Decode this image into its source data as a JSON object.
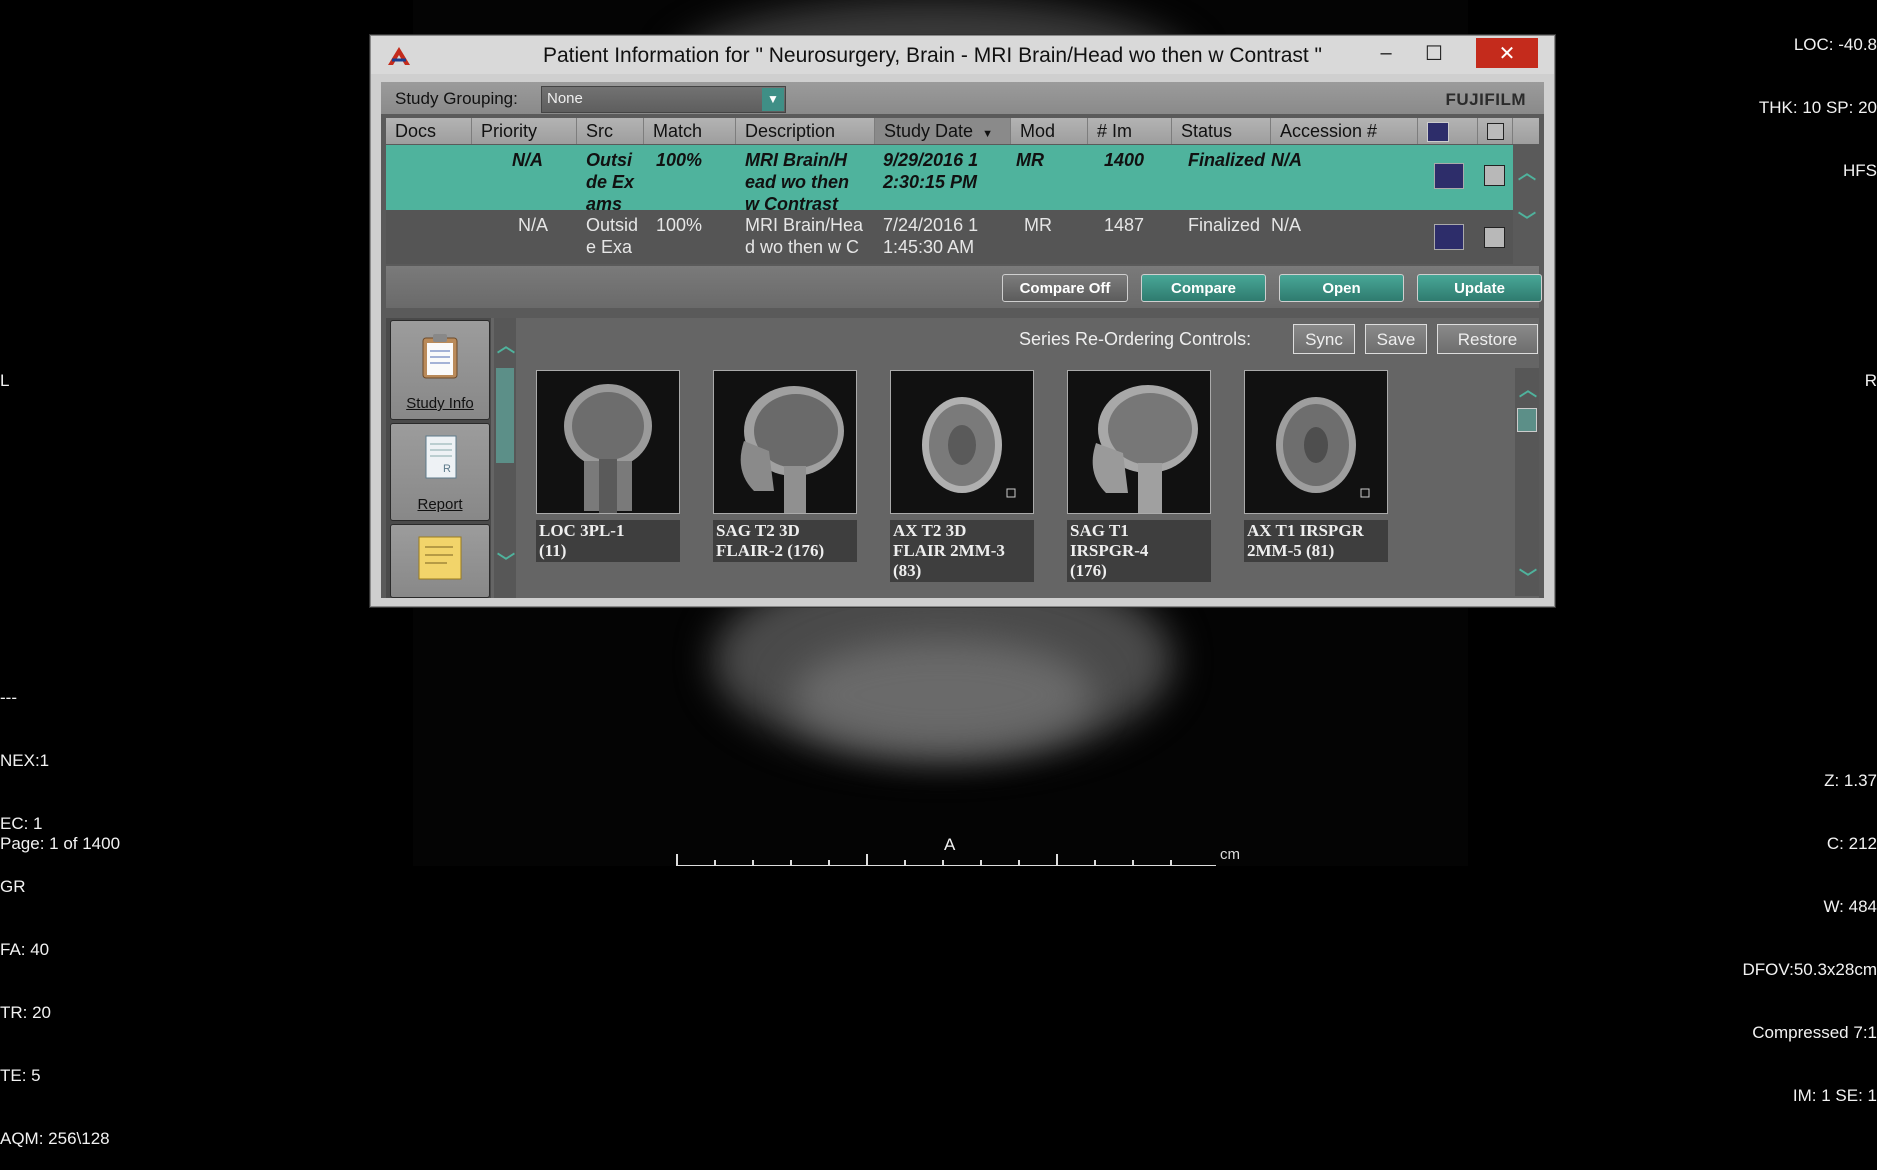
{
  "overlay": {
    "top_right": [
      "LOC: -40.8",
      "THK: 10 SP: 20",
      "HFS"
    ],
    "left_mid": "L",
    "right_mid": "R",
    "bottom_left": [
      "---",
      "NEX:1",
      "EC: 1",
      "GR",
      "FA: 40",
      "TR: 20",
      "TE: 5",
      "AQM: 256\\128"
    ],
    "page": "Page: 1 of 1400",
    "bottom_right": [
      "Z: 1.37",
      "C: 212",
      "W: 484",
      "DFOV:50.3x28cm",
      "Compressed 7:1",
      "IM: 1 SE: 1"
    ],
    "bottom_center": "A",
    "ruler_unit": "cm"
  },
  "window": {
    "title": "Patient Information for \" Neurosurgery, Brain  - MRI Brain/Head wo then w Contrast \"",
    "min_glyph": "–",
    "max_glyph": "☐",
    "close_glyph": "✕"
  },
  "toolbar": {
    "group_label": "Study Grouping:",
    "group_value": "None",
    "brand": "FUJIFILM"
  },
  "columns": [
    "Docs",
    "Priority",
    "Src",
    "Match",
    "Description",
    "Study Date",
    "Mod",
    "# Im",
    "Status",
    "Accession #"
  ],
  "studies": [
    {
      "docs": "",
      "priority": "N/A",
      "src": "Outsi\nde Ex\nams",
      "match": "100%",
      "description": "MRI Brain/H\nead wo then\nw Contrast",
      "date": "9/29/2016 1\n2:30:15 PM",
      "mod": "MR",
      "images": "1400",
      "status": "Finalized",
      "accession": "N/A"
    },
    {
      "docs": "",
      "priority": "N/A",
      "src": "Outsid\ne Exa",
      "match": "100%",
      "description": "MRI Brain/Hea\nd wo then w C",
      "date": "7/24/2016 1\n1:45:30 AM",
      "mod": "MR",
      "images": "1487",
      "status": "Finalized",
      "accession": "N/A"
    }
  ],
  "actions": {
    "compare_off": "Compare Off",
    "compare": "Compare",
    "open": "Open",
    "update": "Update"
  },
  "sidebar": {
    "study_info": "Study Info",
    "report": "Report"
  },
  "reorder": {
    "label": "Series Re-Ordering Controls:",
    "sync": "Sync",
    "save": "Save",
    "restore": "Restore"
  },
  "series": [
    {
      "label": "LOC 3PL-1\n(11)",
      "view": "coronal"
    },
    {
      "label": "SAG T2 3D\nFLAIR-2 (176)",
      "view": "sagittal"
    },
    {
      "label": "AX T2 3D\nFLAIR 2MM-3\n(83)",
      "view": "axial"
    },
    {
      "label": "SAG T1\nIRSPGR-4\n(176)",
      "view": "sagittal"
    },
    {
      "label": "AX T1 IRSPGR\n2MM-5 (81)",
      "view": "axial"
    }
  ],
  "colors": {
    "accent": "#4fb39d",
    "close": "#c42b1c"
  }
}
